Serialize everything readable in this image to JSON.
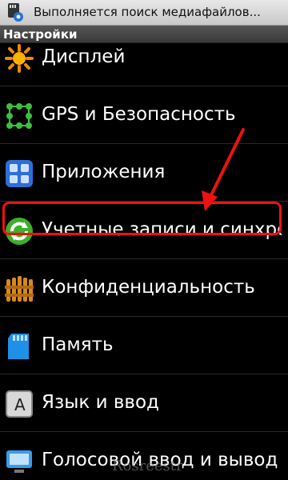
{
  "status_bar": {
    "notification": "Выполняется поиск медиафайлов...",
    "icon": "sd-card-scan-icon"
  },
  "header": {
    "title": "Настройки"
  },
  "settings": {
    "items": [
      {
        "label": "Дисплей",
        "icon": "display-sun-icon"
      },
      {
        "label": "GPS и Безопасность",
        "icon": "gps-security-icon"
      },
      {
        "label": "Приложения",
        "icon": "applications-icon"
      },
      {
        "label": "Учетные записи и синхронизация",
        "icon": "sync-icon"
      },
      {
        "label": "Конфиденциальность",
        "icon": "privacy-icon"
      },
      {
        "label": "Память",
        "icon": "memory-card-icon"
      },
      {
        "label": "Язык и ввод",
        "icon": "language-icon"
      },
      {
        "label": "Голосовой ввод и вывод",
        "icon": "voice-io-icon"
      }
    ]
  },
  "annotation": {
    "highlight_color": "#ee1111",
    "highlighted_item": "Учетные записи и синхронизация"
  },
  "watermark": {
    "text": "Rosreestr"
  }
}
